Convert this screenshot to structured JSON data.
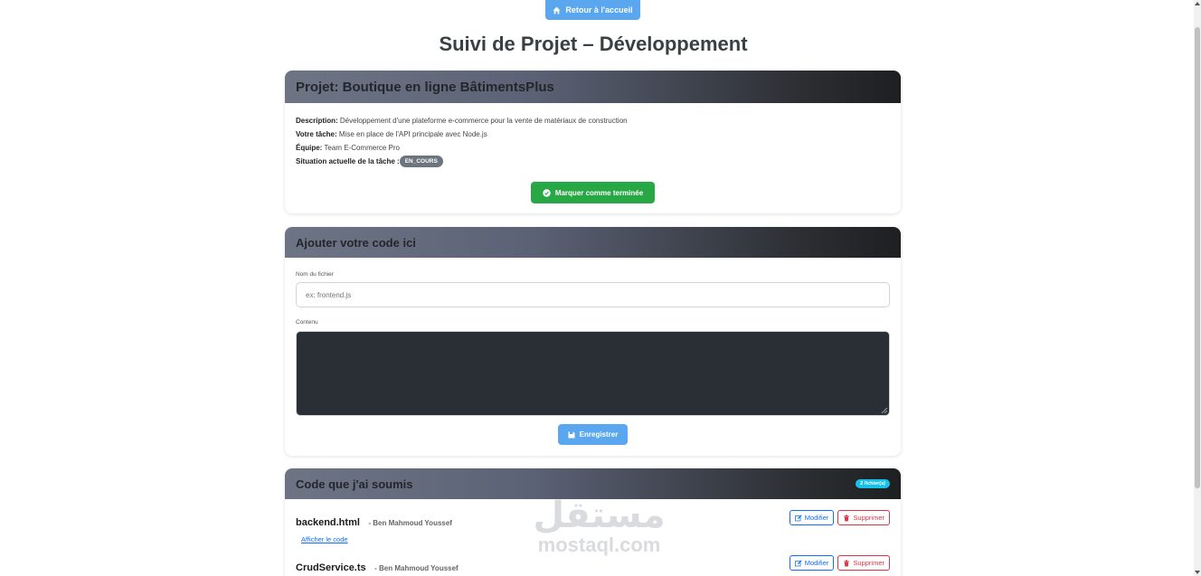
{
  "nav": {
    "home_label": "Retour à l'accueil"
  },
  "page": {
    "title": "Suivi de Projet – Développement"
  },
  "project": {
    "header": "Projet: Boutique en ligne BâtimentsPlus",
    "description_label": "Description:",
    "description": "Développement d'une plateforme e-commerce pour la vente de matériaux de construction",
    "task_label": "Votre tâche:",
    "task": "Mise en place de l'API principale avec Node.js",
    "team_label": "Équipe:",
    "team": "Team E-Commerce Pro",
    "status_label": "Situation actuelle de la tâche :",
    "status": "EN_COURS",
    "done_button": "Marquer comme terminée"
  },
  "add_code": {
    "header": "Ajouter votre code ici",
    "filename_label": "Nom du fichier",
    "filename_placeholder": "ex: frontend.js",
    "content_label": "Contenu",
    "content_value": "",
    "save_button": "Enregistrer"
  },
  "submitted": {
    "header": "Code que j'ai soumis",
    "count": "2 fichier(s)",
    "files": [
      {
        "name": "backend.html",
        "author": "- Ben Mahmoud Youssef",
        "view": "Afficher le code",
        "edit": "Modifier",
        "delete": "Supprimer"
      },
      {
        "name": "CrudService.ts",
        "author": "- Ben Mahmoud Youssef",
        "edit": "Modifier",
        "delete": "Supprimer"
      }
    ]
  },
  "watermark": {
    "arabic": "مستقل",
    "latin": "mostaql.com"
  },
  "colors": {
    "primary": "#5aa7f0",
    "success": "#28a745",
    "danger": "#dc3545",
    "info": "#17c1e8",
    "status_badge": "#6c757d"
  }
}
